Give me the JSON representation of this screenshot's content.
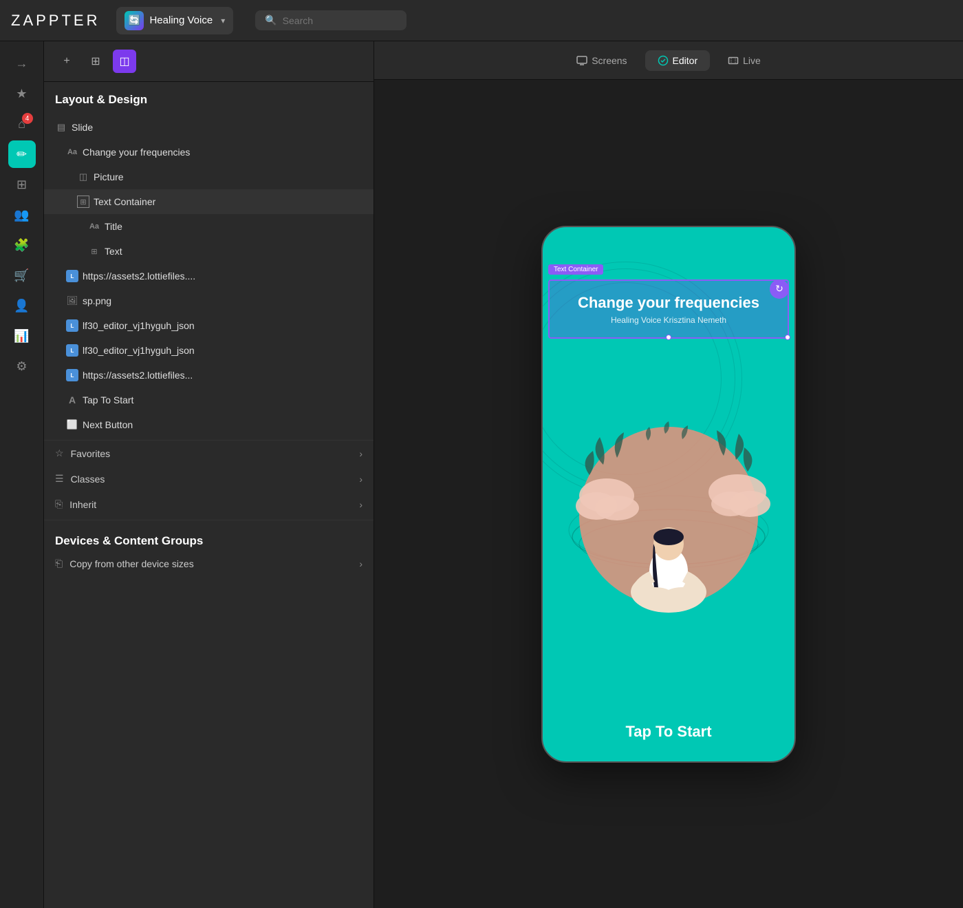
{
  "app": {
    "logo": "ZAPPTER",
    "name": "Healing Voice",
    "dropdown_arrow": "▾"
  },
  "search": {
    "placeholder": "Search"
  },
  "topbar_tabs": {
    "screens": "Screens",
    "editor": "Editor",
    "live": "Live"
  },
  "panel": {
    "title": "Layout & Design",
    "toolbar": {
      "add": "+",
      "components": "⊞",
      "active": "◫"
    }
  },
  "tree": {
    "slide": {
      "label": "Slide",
      "icon": "▤"
    },
    "change_frequencies": {
      "label": "Change your frequencies",
      "icon": "Aa"
    },
    "picture": {
      "label": "Picture",
      "icon": "◫"
    },
    "text_container": {
      "label": "Text Container",
      "icon": "⊞"
    },
    "title": {
      "label": "Title",
      "icon": "Aa"
    },
    "text": {
      "label": "Text",
      "icon": "⊞"
    },
    "lottie1": {
      "label": "https://assets2.lottiefiles...."
    },
    "sp_png": {
      "label": "sp.png",
      "icon": "🖼"
    },
    "lottie2": {
      "label": "lf30_editor_vj1hyguh_json"
    },
    "lottie3": {
      "label": "lf30_editor_vj1hyguh_json"
    },
    "lottie4": {
      "label": "https://assets2.lottiefiles..."
    },
    "tap_to_start": {
      "label": "Tap To Start",
      "icon": "A"
    },
    "next_button": {
      "label": "Next Button",
      "icon": "⬜"
    }
  },
  "sections": {
    "favorites": "Favorites",
    "classes": "Classes",
    "inherit": "Inherit"
  },
  "devices_content": {
    "title": "Devices & Content Groups",
    "copy_label": "Copy from other device sizes"
  },
  "canvas": {
    "phone": {
      "title": "Change your frequencies",
      "subtitle": "Healing Voice Krisztina Nemeth",
      "tap_label": "Tap To Start",
      "text_container_label": "Text Container",
      "bg_color": "#00c8b4"
    }
  },
  "icons": {
    "signin": "→",
    "star": "★",
    "home": "⌂",
    "edit": "✏",
    "grid": "⊞",
    "users": "👥",
    "puzzle": "🧩",
    "cart": "🛒",
    "team": "👤",
    "chart": "📊",
    "settings": "⚙",
    "filter": "⫶",
    "magic": "✦",
    "more": "…",
    "chevron_down": "▾",
    "chevron_right": "›",
    "refresh": "↻"
  },
  "badge_count": "4"
}
